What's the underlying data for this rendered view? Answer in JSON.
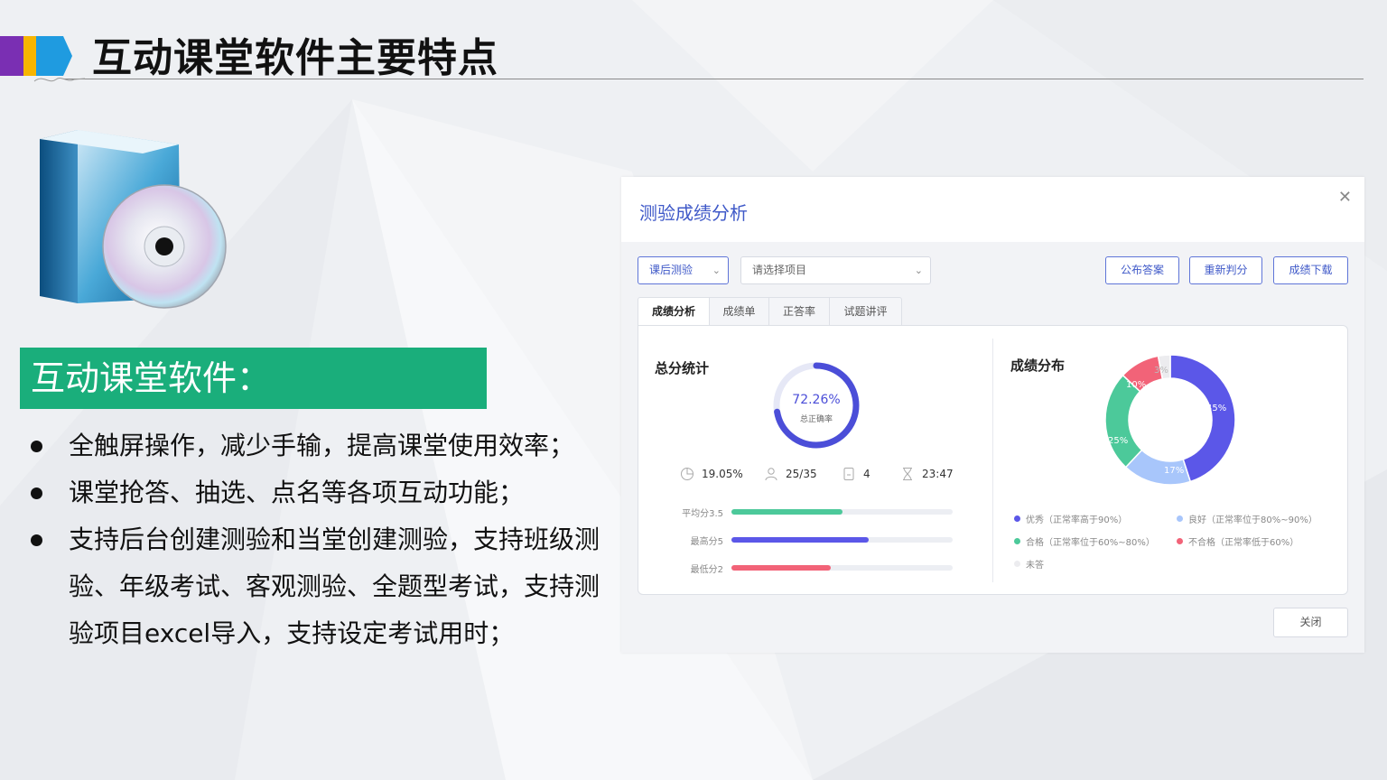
{
  "header": {
    "title": "互动课堂软件主要特点"
  },
  "section": {
    "label": "互动课堂软件：",
    "bullets": [
      "全触屏操作，减少手输，提高课堂使用效率；",
      "课堂抢答、抽选、点名等各项互动功能；",
      "支持后台创建测验和当堂创建测验，支持班级测验、年级考试、客观测验、全题型考试，支持测验项目excel导入，支持设定考试用时；"
    ]
  },
  "dialog": {
    "title": "测验成绩分析",
    "close_icon": "close-icon",
    "filters": {
      "type_value": "课后测验",
      "project_placeholder": "请选择项目"
    },
    "actions": {
      "publish": "公布答案",
      "rejudge": "重新判分",
      "download": "成绩下载"
    },
    "tabs": [
      "成绩分析",
      "成绩单",
      "正答率",
      "试题讲评"
    ],
    "summary": {
      "title": "总分统计",
      "accuracy_value": "72.26%",
      "accuracy_percent": 72.26,
      "accuracy_label": "总正确率",
      "stats": [
        {
          "icon": "pie-icon",
          "value": "19.05%"
        },
        {
          "icon": "user-icon",
          "value": "25/35"
        },
        {
          "icon": "document-icon",
          "value": "4"
        },
        {
          "icon": "hourglass-icon",
          "value": "23:47"
        }
      ],
      "bars": [
        {
          "label": "平均分3.5",
          "fraction": 0.5,
          "color": "#4cc99a"
        },
        {
          "label": "最高分5",
          "fraction": 0.62,
          "color": "#5b57e8"
        },
        {
          "label": "最低分2",
          "fraction": 0.45,
          "color": "#f26378"
        }
      ]
    },
    "distribution": {
      "title": "成绩分布",
      "slices": [
        {
          "key": "excellent",
          "percent": 45,
          "label": "45%",
          "color": "#5b57e8"
        },
        {
          "key": "good",
          "percent": 17,
          "label": "17%",
          "color": "#a8c6fb"
        },
        {
          "key": "pass",
          "percent": 25,
          "label": "25%",
          "color": "#4cc99a"
        },
        {
          "key": "fail",
          "percent": 10,
          "label": "10%",
          "color": "#f26378"
        },
        {
          "key": "absent",
          "percent": 3,
          "label": "3%",
          "color": "#ececef"
        }
      ],
      "legend": [
        {
          "label": "优秀（正常率高于90%）",
          "color": "#5b57e8"
        },
        {
          "label": "良好（正常率位于80%~90%）",
          "color": "#a8c6fb"
        },
        {
          "label": "合格（正常率位于60%~80%）",
          "color": "#4cc99a"
        },
        {
          "label": "不合格（正常率低于60%）",
          "color": "#f26378"
        },
        {
          "label": "未答",
          "color": "#ececef"
        }
      ]
    },
    "footer": {
      "close": "关闭"
    }
  },
  "colors": {
    "accent_green": "#1aae7b",
    "accent_blue": "#3f59c8"
  }
}
